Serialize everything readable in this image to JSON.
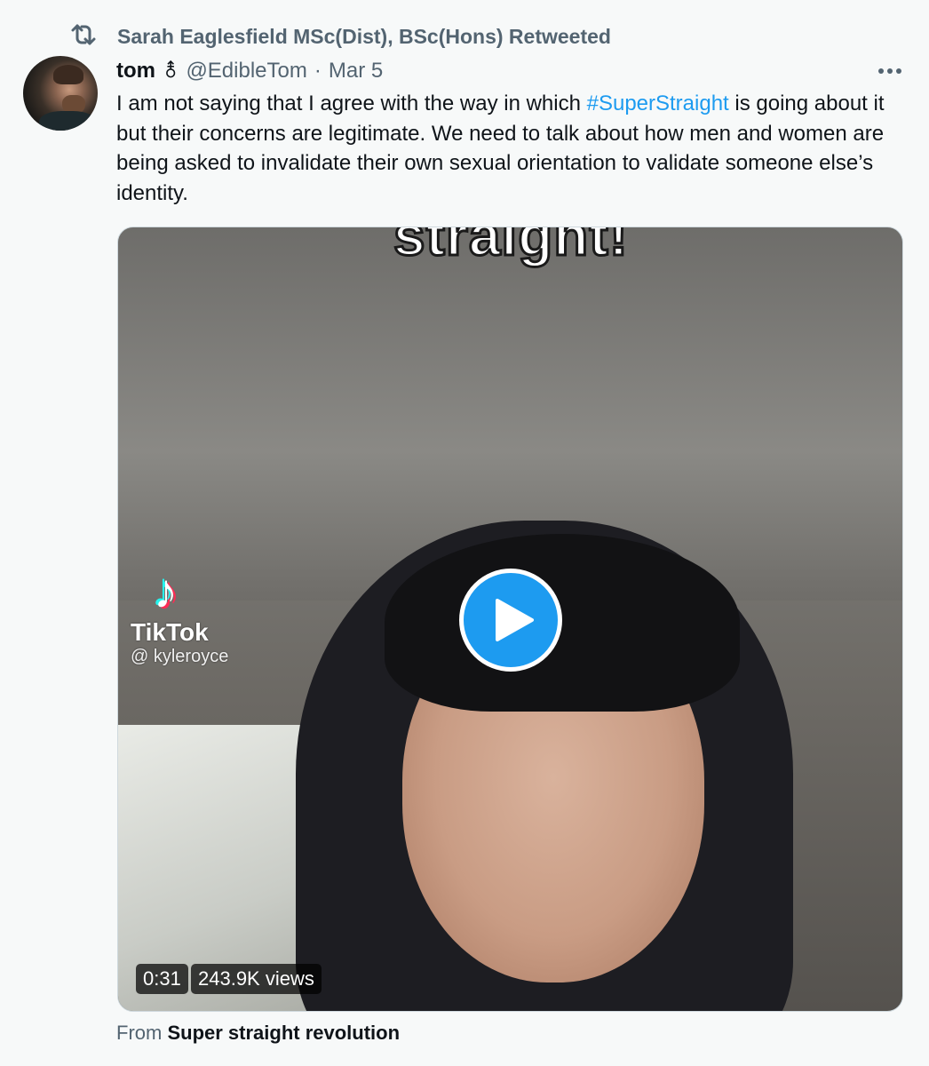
{
  "retweet": {
    "icon": "retweet-icon",
    "text": "Sarah Eaglesfield MSc(Dist), BSc(Hons) Retweeted"
  },
  "tweet": {
    "author_name": "tom",
    "author_symbol": "⚨",
    "handle": "@EdibleTom",
    "separator": "·",
    "date": "Mar 5",
    "more_icon": "more-horizontal-icon",
    "text_before": "I am not saying that I agree with the way in which ",
    "hashtag": "#SuperStraight",
    "text_after": " is going about it but their concerns are legitimate. We need to talk about how men and women are being asked to invalidate their own sexual orientation to validate someone else’s identity."
  },
  "media": {
    "caption_top": "straight!",
    "watermark_brand": "TikTok",
    "watermark_user": "@ kyleroyce",
    "play_icon": "play-icon",
    "duration": "0:31",
    "views": "243.9K views"
  },
  "source": {
    "label": "From",
    "link": "Super straight revolution"
  },
  "colors": {
    "accent": "#1d9bf0",
    "secondary_text": "#536471",
    "primary_text": "#0f1419",
    "background": "#f7f9f9"
  }
}
